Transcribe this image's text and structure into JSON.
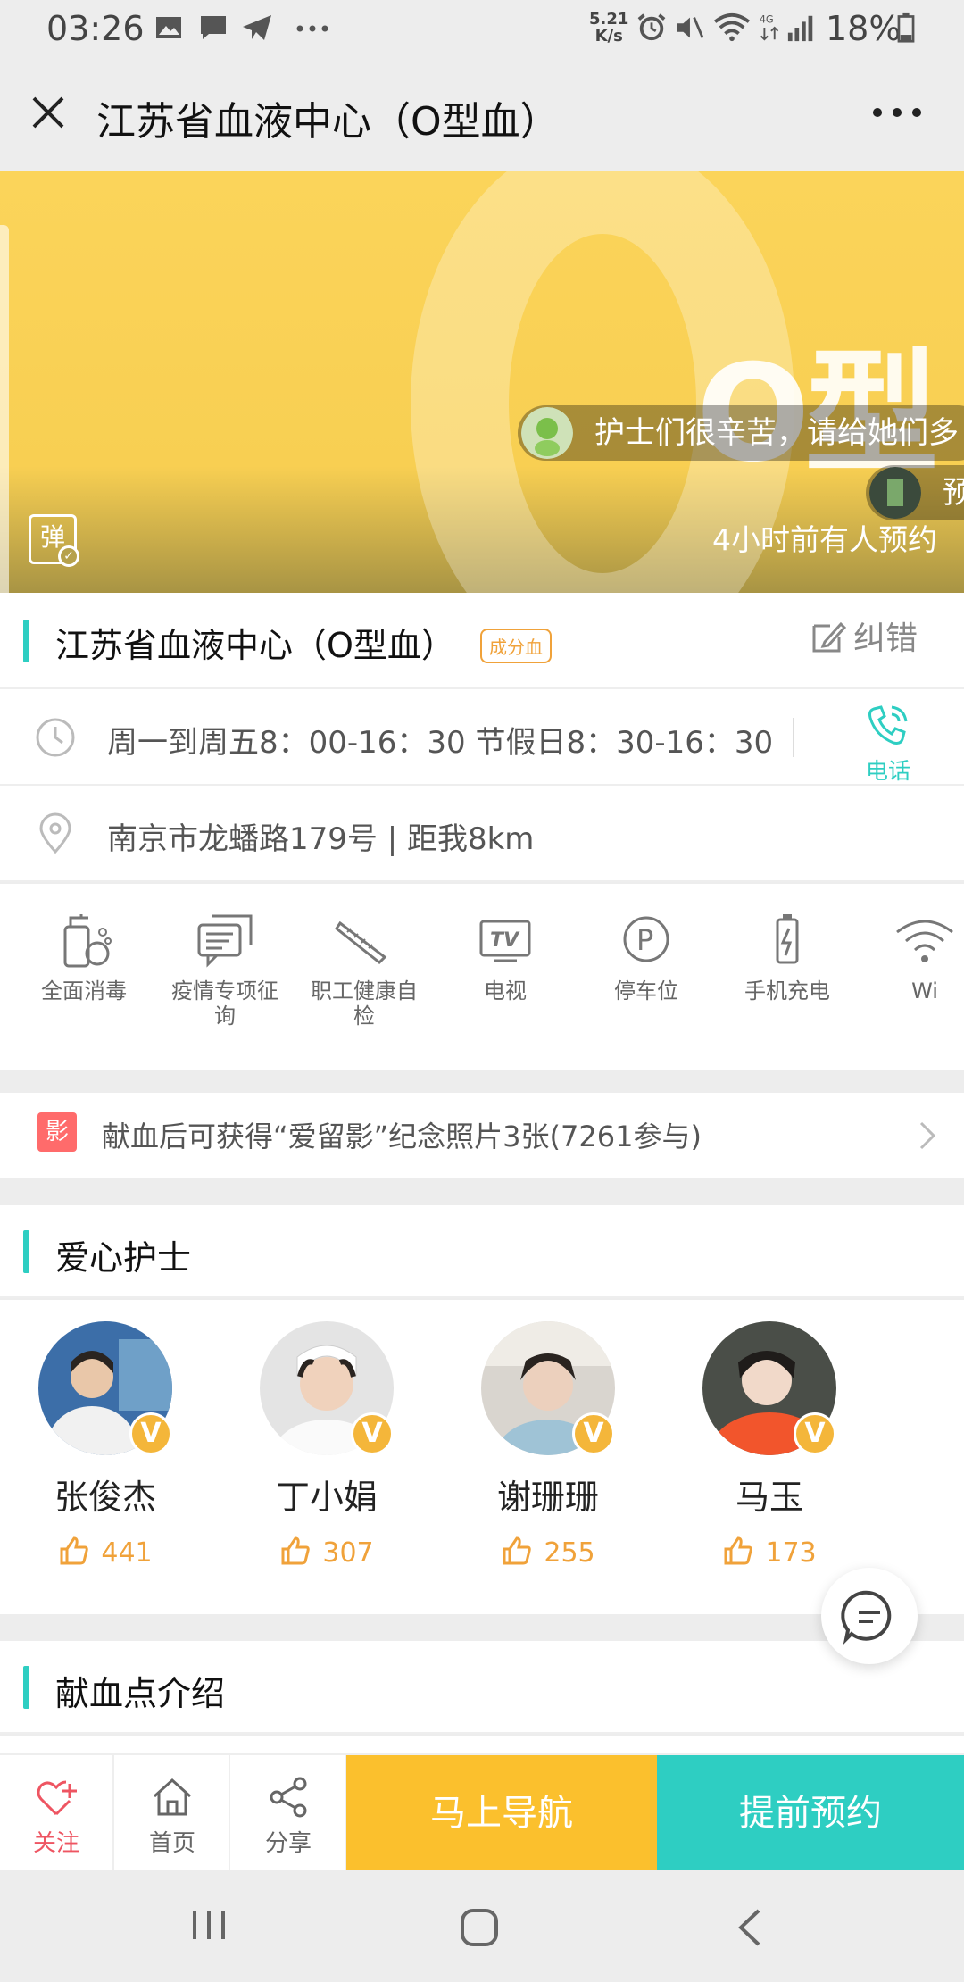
{
  "status_bar": {
    "time": "03:26",
    "net_speed_top": "5.21",
    "net_speed_unit": "K/s",
    "battery": "18%"
  },
  "header": {
    "title": "江苏省血液中心（O型血）"
  },
  "banner": {
    "watermark_text": "O型",
    "danmu": [
      {
        "text": "护士们很辛苦，请给她们多"
      },
      {
        "text": "预"
      }
    ],
    "booked_text": "4小时前有人预约",
    "toggle_label": "弹"
  },
  "info": {
    "name": "江苏省血液中心（O型血）",
    "tag": "成分血",
    "correct_label": "纠错",
    "hours": "周一到周五8：00-16：30 节假日8：30-16：30",
    "phone_label": "电话",
    "address": "南京市龙蟠路179号 | 距我8km"
  },
  "facilities": [
    {
      "label": "全面消毒",
      "icon": "disinfect-icon"
    },
    {
      "label": "疫情专项征询",
      "icon": "consult-icon"
    },
    {
      "label": "职工健康自检",
      "icon": "thermometer-icon"
    },
    {
      "label": "电视",
      "icon": "tv-icon"
    },
    {
      "label": "停车位",
      "icon": "parking-icon"
    },
    {
      "label": "手机充电",
      "icon": "battery-icon"
    },
    {
      "label": "Wi",
      "icon": "wifi-icon"
    }
  ],
  "photo_promo": {
    "badge": "影",
    "text": "献血后可获得“爱留影”纪念照片3张(7261参与)"
  },
  "nurses_section": {
    "title": "爱心护士"
  },
  "nurses": [
    {
      "name": "张俊杰",
      "likes": "441"
    },
    {
      "name": "丁小娟",
      "likes": "307"
    },
    {
      "name": "谢珊珊",
      "likes": "255"
    },
    {
      "name": "马玉",
      "likes": "173"
    }
  ],
  "intro_section": {
    "title": "献血点介绍"
  },
  "toolbar": {
    "follow": "关注",
    "home": "首页",
    "share": "分享",
    "navigate": "马上导航",
    "book": "提前预约"
  },
  "colors": {
    "accent": "#2ecec2",
    "banner": "#fbd45a",
    "orange": "#f0a23a",
    "nav_button": "#fbc02d",
    "follow": "#ee5562"
  }
}
